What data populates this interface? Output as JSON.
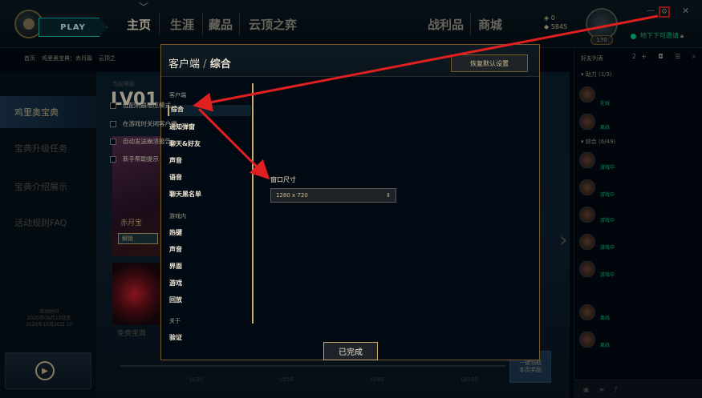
{
  "topbar": {
    "play_label": "PLAY",
    "nav": [
      "主页",
      "生涯",
      "藏品",
      "云顶之弈",
      "战利品",
      "商城"
    ],
    "currency_rp": "0",
    "currency_be": "5845",
    "profile_level": "170",
    "status_text": "地下下可邀请"
  },
  "background": {
    "subnav": [
      "首页",
      "鸡里奥宝典：赤月篇",
      "云顶之"
    ],
    "menu": [
      "鸡里奥宝典",
      "宝典升级任务",
      "宝典介绍展示",
      "活动规则FAQ"
    ],
    "level_label": "当前等级",
    "level_value": "LV01",
    "pass_label": "赤月宝",
    "pass_button": "解锁",
    "reward_label": "免费宝典",
    "left_time": "活动时间\n2020年09月23日至\n2020年10月26日 10",
    "right_card": "一键领取\n本页奖励",
    "progress_labels": [
      "LV20",
      "LV50",
      "LV80",
      "LV100"
    ]
  },
  "social": {
    "header": "好友列表",
    "tools": "2+ ◘ ☰ ⌕",
    "group_1": "▾ 助力 (1/3)",
    "group_2": "▾ 综合 (6/49)",
    "friends": [
      {
        "status": "在线"
      },
      {
        "status": "离线"
      },
      {
        "status": "游戏中"
      },
      {
        "status": "游戏中"
      },
      {
        "status": "游戏中"
      },
      {
        "status": "游戏中"
      },
      {
        "status": "游戏中"
      },
      {
        "status": "离线"
      },
      {
        "status": "离线"
      }
    ]
  },
  "modal": {
    "title_section": "客户端",
    "title_separator": "/",
    "title_page": "综合",
    "reset_label": "恢复默认设置",
    "categories": {
      "client_head": "客户端",
      "client": [
        "综合",
        "通知弹窗",
        "聊天&好友",
        "声音",
        "语音",
        "聊天黑名单"
      ],
      "game_head": "游戏内",
      "game": [
        "热键",
        "声音",
        "界面",
        "游戏",
        "回放"
      ],
      "about_head": "关于",
      "about": [
        "验证"
      ]
    },
    "options": [
      "低配机器适应模式",
      "在游戏时关闭客户端",
      "自动发送崩溃报告",
      "新手帮助提示"
    ],
    "window_size_label": "窗口尺寸",
    "window_size_value": "1280 x 720",
    "done_label": "已完成"
  },
  "colors": {
    "accent_gold": "#c8aa6e",
    "annotation_red": "#e02020",
    "online_green": "#0acf83"
  }
}
